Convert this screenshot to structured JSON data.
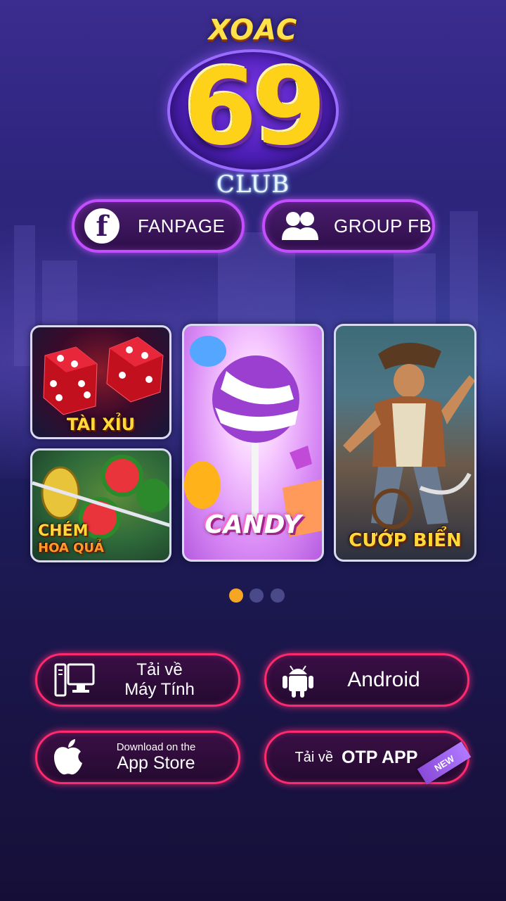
{
  "logo": {
    "top": "XOAC",
    "number": "69",
    "bottom": "CLUB"
  },
  "social": {
    "fanpage_label": "FANPAGE",
    "groupfb_label": "GROUP FB"
  },
  "games": [
    {
      "title": "TÀI XỈU"
    },
    {
      "title_line1": "CHÉM",
      "title_line2": "HOA QUẢ"
    },
    {
      "title": "CANDY"
    },
    {
      "title": "CƯỚP BIỂN"
    }
  ],
  "pagination": {
    "count": 3,
    "active_index": 0
  },
  "downloads": {
    "pc_line1": "Tải về",
    "pc_line2": "Máy Tính",
    "android_label": "Android",
    "appstore_small": "Download on the",
    "appstore_big": "App Store",
    "otp_small": "Tải về",
    "otp_big": "OTP APP",
    "new_badge": "NEW"
  },
  "colors": {
    "social_border": "#c34dff",
    "download_border": "#ff2a6d",
    "dot_active": "#f5a623",
    "dot_inactive": "#4a4a8a",
    "logo_gold": "#ffd21a"
  }
}
